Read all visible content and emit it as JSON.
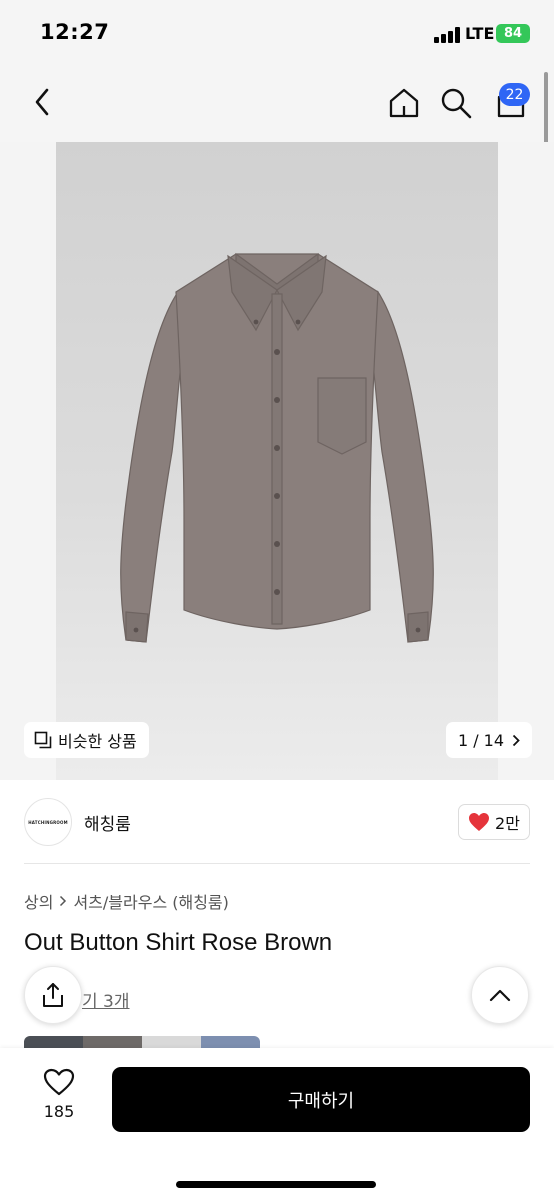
{
  "status_bar": {
    "time": "12:27",
    "network": "LTE",
    "battery": "84"
  },
  "nav": {
    "cart_count": "22",
    "icons": [
      "back-icon",
      "home-icon",
      "search-icon",
      "cart-icon"
    ]
  },
  "gallery": {
    "similar_label": "비슷한 상품",
    "counter": "1 / 14"
  },
  "brand": {
    "logo_text": "HATCHINGROOM",
    "name": "해칭룸",
    "likes": "2만"
  },
  "product": {
    "breadcrumb": [
      "상의",
      "셔츠/블라우스 (해칭룸)"
    ],
    "title": "Out Button Shirt Rose Brown",
    "review_link": "기 3개"
  },
  "swatch_colors": [
    "#4b4f55",
    "#6e6a68",
    "#d9d9d9",
    "#7d8fb0"
  ],
  "bottom_bar": {
    "wish_count": "185",
    "buy_label": "구매하기"
  },
  "colors": {
    "badge": "#2f66f5",
    "battery": "#34c759",
    "heart": "#e5343b",
    "shirt": "#8a7f7c"
  }
}
